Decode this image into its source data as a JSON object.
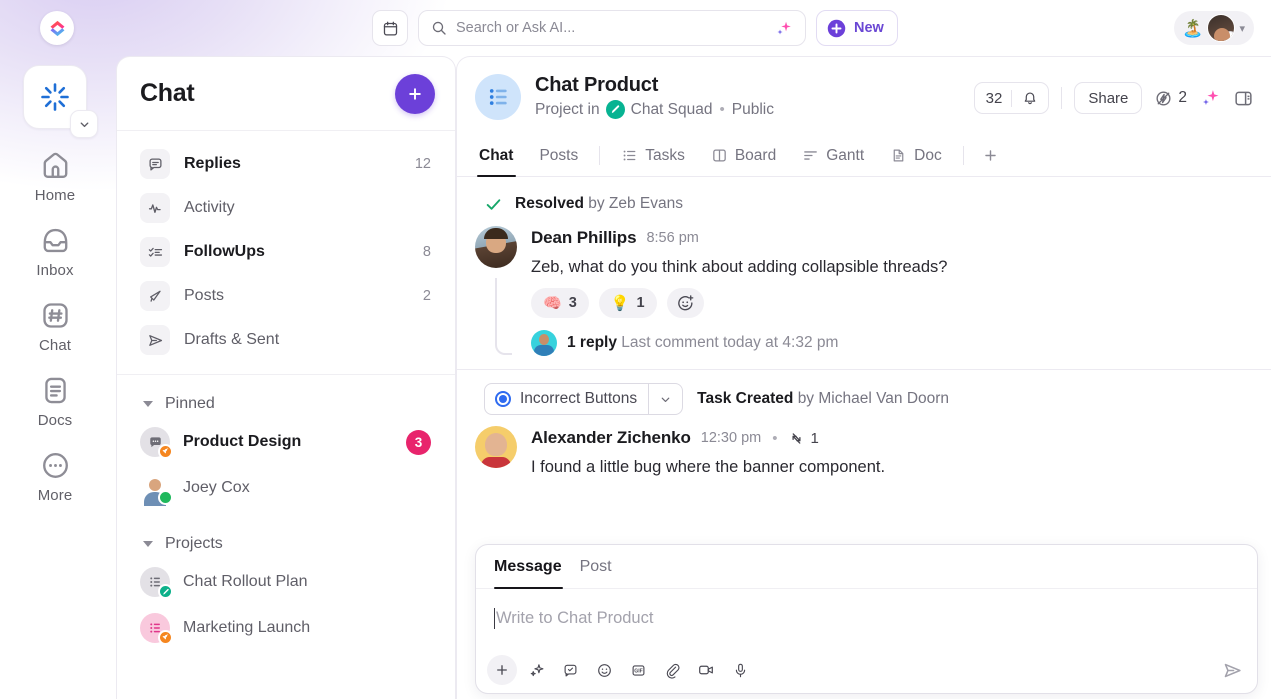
{
  "topbar": {
    "calendar_icon": "calendar-icon",
    "search": {
      "placeholder": "Search or Ask AI...",
      "icon": "search-icon",
      "ai_icon": "ai-sparkle-icon"
    },
    "new_button": {
      "label": "New",
      "icon": "plus-circle-icon"
    },
    "status_emoji": "🏝️",
    "account_chevron": "chevron-down-icon",
    "logo": "clickup-logo-icon"
  },
  "rail": {
    "workspace_icon": "workspace-spinner-icon",
    "workspace_chevron": "chevron-down-icon",
    "items": [
      {
        "label": "Home",
        "icon": "home-icon"
      },
      {
        "label": "Inbox",
        "icon": "inbox-icon"
      },
      {
        "label": "Chat",
        "icon": "hash-square-icon"
      },
      {
        "label": "Docs",
        "icon": "document-icon"
      },
      {
        "label": "More",
        "icon": "ellipsis-circle-icon"
      }
    ]
  },
  "sidebar": {
    "title": "Chat",
    "add_button_icon": "plus-icon",
    "nav": [
      {
        "label": "Replies",
        "count": "12",
        "icon": "comment-icon",
        "active": true
      },
      {
        "label": "Activity",
        "count": "",
        "icon": "activity-icon",
        "active": false
      },
      {
        "label": "FollowUps",
        "count": "8",
        "icon": "checklist-icon",
        "active": true
      },
      {
        "label": "Posts",
        "count": "2",
        "icon": "megaphone-icon",
        "active": false
      },
      {
        "label": "Drafts & Sent",
        "count": "",
        "icon": "send-icon",
        "active": false
      }
    ],
    "sections": [
      {
        "title": "Pinned",
        "items": [
          {
            "label": "Product Design",
            "badge": "3",
            "icon": "chat-bubble-icon",
            "sub_icon": "rocket-badge-icon",
            "strong": true
          },
          {
            "label": "Joey Cox",
            "badge": "",
            "icon": "user-avatar",
            "sub_icon": "online-dot",
            "strong": false
          }
        ]
      },
      {
        "title": "Projects",
        "items": [
          {
            "label": "Chat Rollout Plan",
            "badge": "",
            "icon": "list-icon",
            "sub_icon": "pen-badge-icon",
            "strong": false
          },
          {
            "label": "Marketing Launch",
            "badge": "",
            "icon": "list-icon",
            "sub_icon": "rocket-badge-icon",
            "strong": false
          }
        ]
      }
    ]
  },
  "main": {
    "header": {
      "icon": "project-list-icon",
      "title": "Chat Product",
      "subtitle_prefix": "Project in",
      "space_icon": "pen-circle-icon",
      "space_name": "Chat Squad",
      "separator": "•",
      "visibility": "Public",
      "member_count": "32",
      "bell_icon": "bell-icon",
      "share_label": "Share",
      "automation_icon": "automation-bolt-icon",
      "automation_count": "2",
      "ai_icon": "ai-sparkle-icon",
      "panel_icon": "sidebar-panel-icon"
    },
    "tabs": [
      {
        "label": "Chat",
        "icon": "",
        "active": true
      },
      {
        "label": "Posts",
        "icon": "",
        "active": false
      },
      {
        "label": "Tasks",
        "icon": "list-icon",
        "active": false
      },
      {
        "label": "Board",
        "icon": "board-icon",
        "active": false
      },
      {
        "label": "Gantt",
        "icon": "gantt-icon",
        "active": false
      },
      {
        "label": "Doc",
        "icon": "doc-icon",
        "active": false
      }
    ],
    "add_tab_icon": "plus-icon",
    "messages": {
      "resolved": {
        "icon": "check-icon",
        "status": "Resolved",
        "by": "by Zeb Evans"
      },
      "first": {
        "author": "Dean Phillips",
        "time": "8:56 pm",
        "text": "Zeb, what do you think about adding collapsible threads?",
        "reactions": [
          {
            "emoji": "🧠",
            "count": "3"
          },
          {
            "emoji": "💡",
            "count": "1"
          }
        ],
        "add_reaction_icon": "add-reaction-icon",
        "reply_count": "1 reply",
        "reply_meta": "Last comment today at 4:32 pm"
      },
      "second": {
        "task_name": "Incorrect Buttons",
        "task_status_icon": "radio-status-icon",
        "task_chevron_icon": "chevron-down-icon",
        "event_label": "Task Created",
        "event_by": "by Michael Van Doorn",
        "author": "Alexander Zichenko",
        "time": "12:30 pm",
        "separator": "•",
        "repost_icon": "repost-icon",
        "repost_count": "1",
        "text": "I found a little bug where the banner component."
      }
    },
    "composer": {
      "tabs": [
        {
          "label": "Message",
          "active": true
        },
        {
          "label": "Post",
          "active": false
        }
      ],
      "placeholder": "Write to Chat Product",
      "tools": [
        "plus-icon",
        "ai-sparkle-icon",
        "task-check-icon",
        "emoji-icon",
        "gif-icon",
        "attachment-icon",
        "video-icon",
        "microphone-icon"
      ],
      "send_icon": "send-icon"
    }
  },
  "colors": {
    "brand_purple": "#6c40d9",
    "badge_pink": "#e8246c",
    "accent_blue": "#2f6bf0",
    "teal": "#07b392",
    "orange": "#f5861f",
    "green": "#1fb85c"
  }
}
